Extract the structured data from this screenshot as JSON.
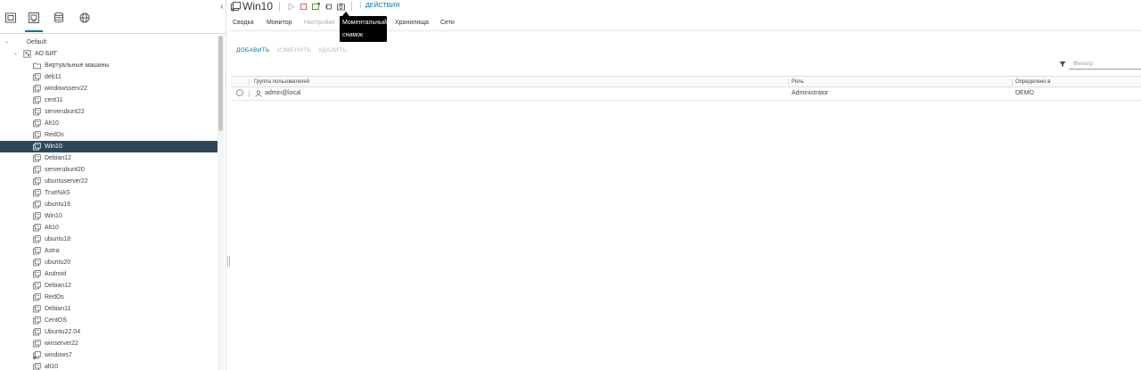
{
  "inventory": {
    "collapse_glyph": "‹",
    "nav_icons": [
      {
        "name": "hosts-clusters-icon"
      },
      {
        "name": "vms-templates-icon"
      },
      {
        "name": "storage-icon"
      },
      {
        "name": "networking-icon"
      }
    ],
    "tree": [
      {
        "label": "Default",
        "caret": "⌄",
        "level": 0,
        "icon": "none"
      },
      {
        "label": "АО БИГ",
        "caret": "⌄",
        "level": 1,
        "icon": "datacenter"
      },
      {
        "label": "Виртуальные машины",
        "level": 2,
        "icon": "folder"
      },
      {
        "label": "deb11",
        "level": 2,
        "icon": "vm"
      },
      {
        "label": "windowsserv22",
        "level": 2,
        "icon": "vm"
      },
      {
        "label": "cent11",
        "level": 2,
        "icon": "vm"
      },
      {
        "label": "serverubunt22",
        "level": 2,
        "icon": "vm"
      },
      {
        "label": "Alt10",
        "level": 2,
        "icon": "vm"
      },
      {
        "label": "RedOs",
        "level": 2,
        "icon": "vm"
      },
      {
        "label": "Win10",
        "level": 2,
        "icon": "vm",
        "selected": true
      },
      {
        "label": "Debian12",
        "level": 2,
        "icon": "vm"
      },
      {
        "label": "serverubunt20",
        "level": 2,
        "icon": "vm"
      },
      {
        "label": "ubuntuserver22",
        "level": 2,
        "icon": "vm"
      },
      {
        "label": "TrueNAS",
        "level": 2,
        "icon": "vm"
      },
      {
        "label": "ubuntu16",
        "level": 2,
        "icon": "vm"
      },
      {
        "label": "Win10",
        "level": 2,
        "icon": "vm"
      },
      {
        "label": "Alt10",
        "level": 2,
        "icon": "vm"
      },
      {
        "label": "ubuntu18",
        "level": 2,
        "icon": "vm"
      },
      {
        "label": "Astra",
        "level": 2,
        "icon": "vm"
      },
      {
        "label": "ubuntu20",
        "level": 2,
        "icon": "vm"
      },
      {
        "label": "Android",
        "level": 2,
        "icon": "vm"
      },
      {
        "label": "Debian12",
        "level": 2,
        "icon": "vm"
      },
      {
        "label": "RedOs",
        "level": 2,
        "icon": "vm"
      },
      {
        "label": "Debian11",
        "level": 2,
        "icon": "vm"
      },
      {
        "label": "CentOS",
        "level": 2,
        "icon": "vm"
      },
      {
        "label": "Ubuntu22.04",
        "level": 2,
        "icon": "vm"
      },
      {
        "label": "winserver22",
        "level": 2,
        "icon": "vm"
      },
      {
        "label": "windows7",
        "level": 2,
        "icon": "vm-on"
      },
      {
        "label": "alt10",
        "level": 2,
        "icon": "vm"
      }
    ]
  },
  "header": {
    "title": "Win10",
    "toolbar_icons": [
      "power-on-icon",
      "power-off-icon",
      "console-icon",
      "migrate-icon",
      "snapshot-icon"
    ],
    "actions_label": "ДЕЙСТВИЯ",
    "actions_icon": "⋮"
  },
  "tabs": [
    {
      "label": "Сводка",
      "disabled": false
    },
    {
      "label": "Монитор",
      "disabled": false
    },
    {
      "label": "Настройки",
      "disabled": true
    },
    {
      "label": "Хранилища",
      "disabled": false
    },
    {
      "label": "Сети",
      "disabled": false
    }
  ],
  "tooltip": {
    "line1": "Моментальный",
    "line2": "снимок"
  },
  "permissions": {
    "add_label": "ДОБАВИТЬ",
    "edit_label": "ИЗМЕНИТЬ",
    "delete_label": "УДАЛИТЬ",
    "filter_placeholder": "Фильтр",
    "columns": [
      "Группа пользователей",
      "Роль",
      "Определено в"
    ],
    "rows": [
      {
        "user": "admin@local",
        "role": "Administrator",
        "defined_in": "DEMO"
      }
    ]
  },
  "colors": {
    "accent": "#0072a3",
    "selected_row": "#2f4859"
  }
}
